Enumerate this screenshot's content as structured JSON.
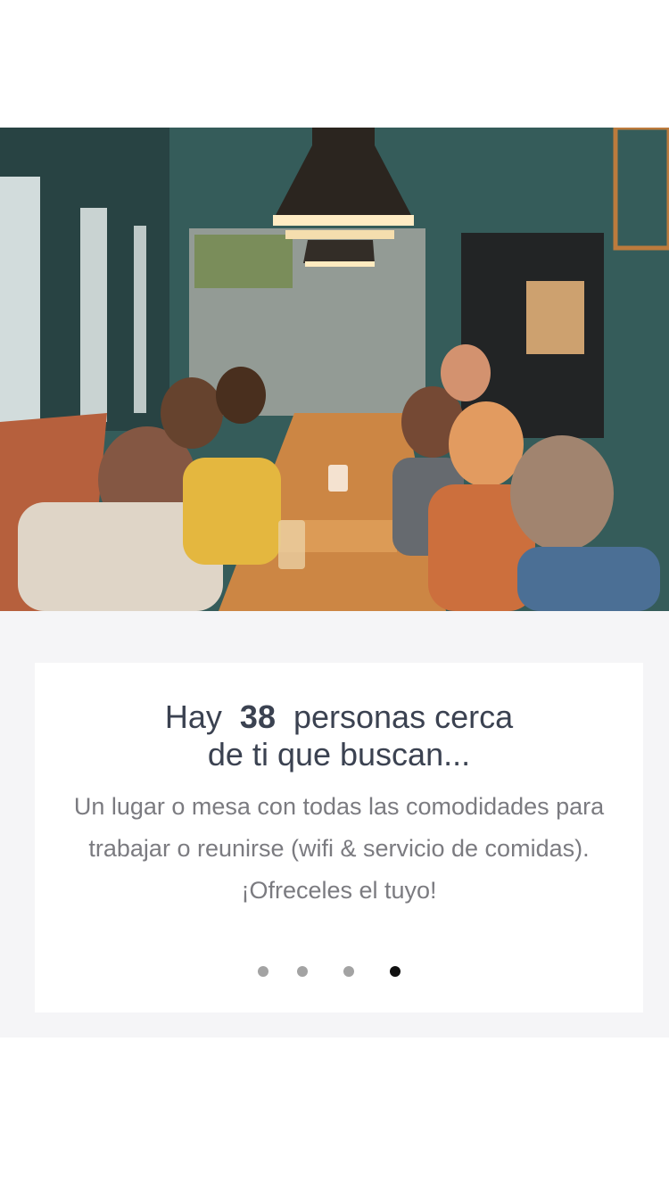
{
  "hero": {
    "image_icon": "restaurant-photo"
  },
  "onboarding": {
    "headline_prefix": "Hay",
    "headline_count": "38",
    "headline_suffix_line1": "personas cerca",
    "headline_line2": "de ti  que buscan...",
    "body": "Un  lugar  o mesa con todas las  comodidades para trabajar o reunirse  (wifi & servicio de comidas).  ¡Ofreceles el tuyo!"
  },
  "pager": {
    "total": 4,
    "active_index": 3
  },
  "colors": {
    "headline": "#3b4251",
    "body_text": "#7b7b80",
    "dot_inactive": "#a3a3a3",
    "dot_active": "#111111",
    "panel_bg": "#f5f5f7"
  }
}
